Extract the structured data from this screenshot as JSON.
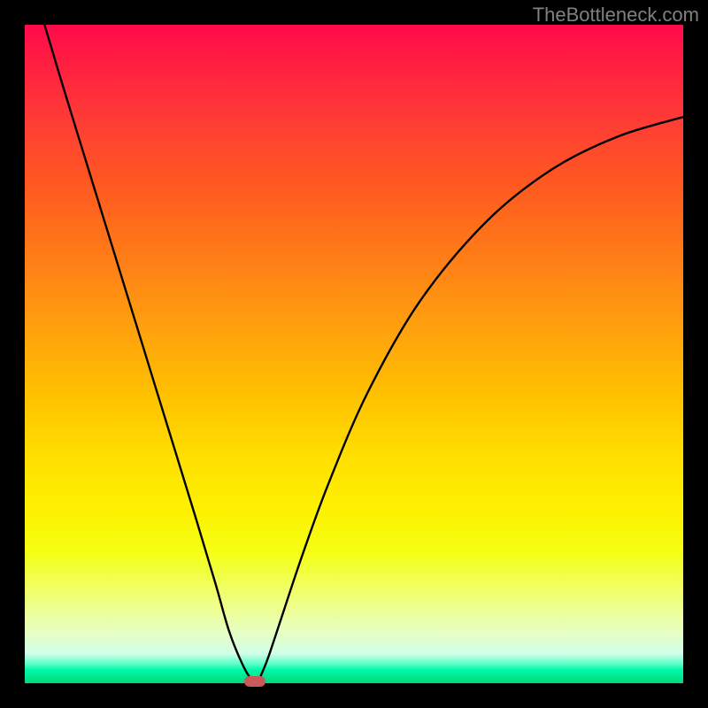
{
  "watermark": "TheBottleneck.com",
  "chart_data": {
    "type": "line",
    "title": "",
    "xlabel": "",
    "ylabel": "",
    "xlim": [
      0,
      100
    ],
    "ylim": [
      0,
      100
    ],
    "grid": false,
    "series": [
      {
        "name": "curve",
        "x": [
          3,
          6,
          10,
          14,
          18,
          22,
          26,
          29,
          31,
          33,
          34.5,
          35.5,
          36,
          37,
          39,
          42,
          46,
          52,
          60,
          70,
          80,
          90,
          100
        ],
        "y": [
          100,
          90,
          77,
          64,
          51,
          38,
          25,
          15,
          8,
          3,
          0.5,
          0.5,
          1.5,
          4,
          10,
          19,
          30,
          44,
          58,
          70,
          78,
          83,
          86
        ]
      }
    ],
    "min_marker": {
      "x": 35,
      "y": 0.3
    },
    "gradient": {
      "top": "#ff0a4a",
      "mid": "#ffe000",
      "bottom": "#00d878"
    }
  }
}
